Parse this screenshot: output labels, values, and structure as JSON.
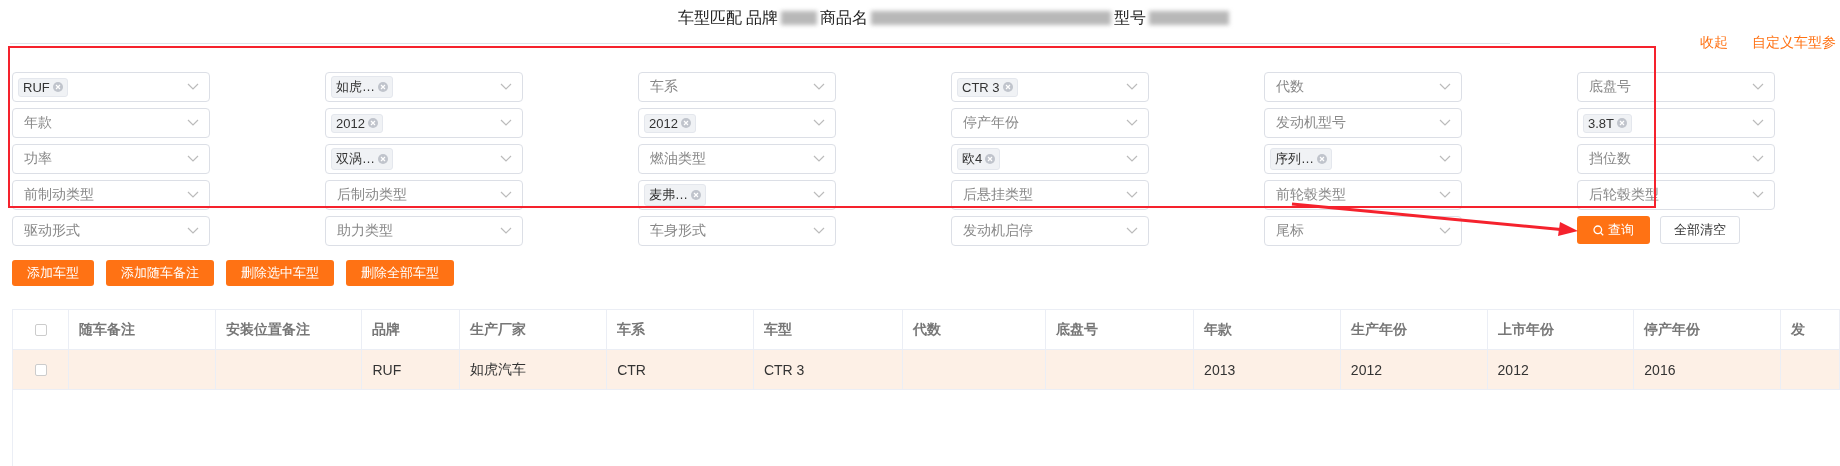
{
  "title": {
    "parts": [
      "车型匹配 品牌",
      "商品名",
      "型号"
    ]
  },
  "links": [
    "收起",
    "自定义车型参"
  ],
  "filters": [
    {
      "kind": "tag",
      "text": "RUF"
    },
    {
      "kind": "tag",
      "text": "如虎…"
    },
    {
      "kind": "placeholder",
      "text": "车系"
    },
    {
      "kind": "tag",
      "text": "CTR 3"
    },
    {
      "kind": "placeholder",
      "text": "代数"
    },
    {
      "kind": "placeholder",
      "text": "底盘号"
    },
    {
      "kind": "placeholder",
      "text": "年款"
    },
    {
      "kind": "tag",
      "text": "2012"
    },
    {
      "kind": "tag",
      "text": "2012"
    },
    {
      "kind": "placeholder",
      "text": "停产年份"
    },
    {
      "kind": "placeholder",
      "text": "发动机型号"
    },
    {
      "kind": "tag",
      "text": "3.8T"
    },
    {
      "kind": "placeholder",
      "text": "功率"
    },
    {
      "kind": "tag",
      "text": "双涡…"
    },
    {
      "kind": "placeholder",
      "text": "燃油类型"
    },
    {
      "kind": "tag",
      "text": "欧4"
    },
    {
      "kind": "tag",
      "text": "序列…"
    },
    {
      "kind": "placeholder",
      "text": "挡位数"
    },
    {
      "kind": "placeholder",
      "text": "前制动类型"
    },
    {
      "kind": "placeholder",
      "text": "后制动类型"
    },
    {
      "kind": "tag",
      "text": "麦弗…"
    },
    {
      "kind": "placeholder",
      "text": "后悬挂类型"
    },
    {
      "kind": "placeholder",
      "text": "前轮毂类型"
    },
    {
      "kind": "placeholder",
      "text": "后轮毂类型"
    },
    {
      "kind": "placeholder",
      "text": "驱动形式"
    },
    {
      "kind": "placeholder",
      "text": "助力类型"
    },
    {
      "kind": "placeholder",
      "text": "车身形式"
    },
    {
      "kind": "placeholder",
      "text": "发动机启停"
    },
    {
      "kind": "placeholder",
      "text": "尾标"
    }
  ],
  "search_buttons": {
    "query": "查询",
    "clear": "全部清空"
  },
  "actions": [
    "添加车型",
    "添加随车备注",
    "删除选中车型",
    "删除全部车型"
  ],
  "table": {
    "all_selected": false,
    "columns": [
      "随车备注",
      "安装位置备注",
      "品牌",
      "生产厂家",
      "车系",
      "车型",
      "代数",
      "底盘号",
      "年款",
      "生产年份",
      "上市年份",
      "停产年份",
      "发"
    ],
    "rows": [
      {
        "selected": false,
        "highlighted": true,
        "cells": [
          "",
          "",
          "RUF",
          "如虎汽车",
          "CTR",
          "CTR 3",
          "",
          "",
          "2013",
          "2012",
          "2012",
          "2016",
          ""
        ]
      }
    ]
  }
}
